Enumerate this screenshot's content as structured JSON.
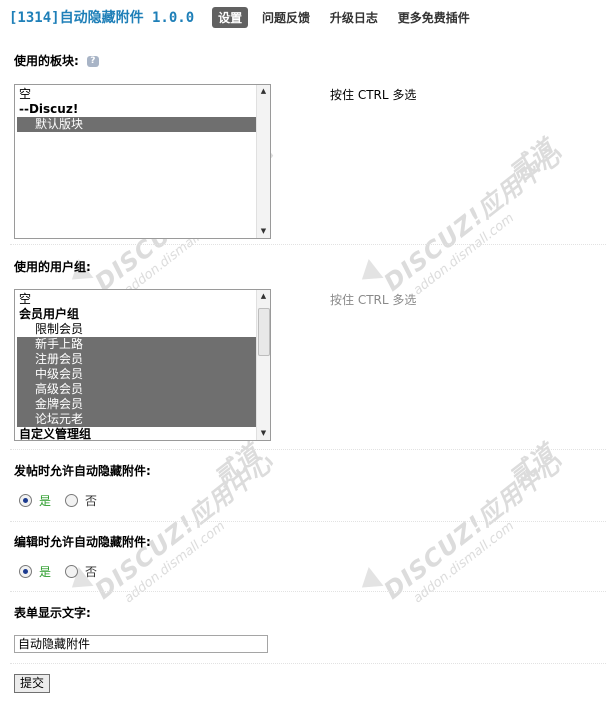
{
  "header": {
    "title": "[1314]自动隐藏附件 1.0.0",
    "nav": [
      "设置",
      "问题反馈",
      "升级日志",
      "更多免费插件"
    ],
    "active_nav": "设置"
  },
  "forums": {
    "label": "使用的板块:",
    "help_icon": "question-bubble-icon",
    "hint": "按住 CTRL 多选",
    "options": [
      {
        "text": "空",
        "selected": false
      },
      {
        "text": "--Discuz!",
        "selected": false
      },
      {
        "text": "默认版块",
        "selected": true
      }
    ]
  },
  "usergroups": {
    "label": "使用的用户组:",
    "hint": "按住 CTRL 多选",
    "options": [
      {
        "text": "空",
        "selected": false
      },
      {
        "text": "会员用户组",
        "selected": false
      },
      {
        "text": "限制会员",
        "selected": false
      },
      {
        "text": "新手上路",
        "selected": true
      },
      {
        "text": "注册会员",
        "selected": true
      },
      {
        "text": "中级会员",
        "selected": true
      },
      {
        "text": "高级会员",
        "selected": true
      },
      {
        "text": "金牌会员",
        "selected": true
      },
      {
        "text": "论坛元老",
        "selected": true
      },
      {
        "text": "自定义管理组",
        "selected": false
      }
    ]
  },
  "allow_post": {
    "label": "发帖时允许自动隐藏附件:",
    "yes": "是",
    "no": "否",
    "value": "是"
  },
  "allow_edit": {
    "label": "编辑时允许自动隐藏附件:",
    "yes": "是",
    "no": "否",
    "value": "是"
  },
  "display_text": {
    "label": "表单显示文字:",
    "value": "自动隐藏附件"
  },
  "submit_label": "提交",
  "watermark": {
    "brand": "DISCUZ!应用中心",
    "url": "addon.dismall.com",
    "mark": "贰道"
  },
  "colors": {
    "title": "#1e7fb8",
    "nav_active_bg": "#616161",
    "selected_option_bg": "#6f6f6f",
    "radio_yes_text": "#2a9b2a"
  }
}
